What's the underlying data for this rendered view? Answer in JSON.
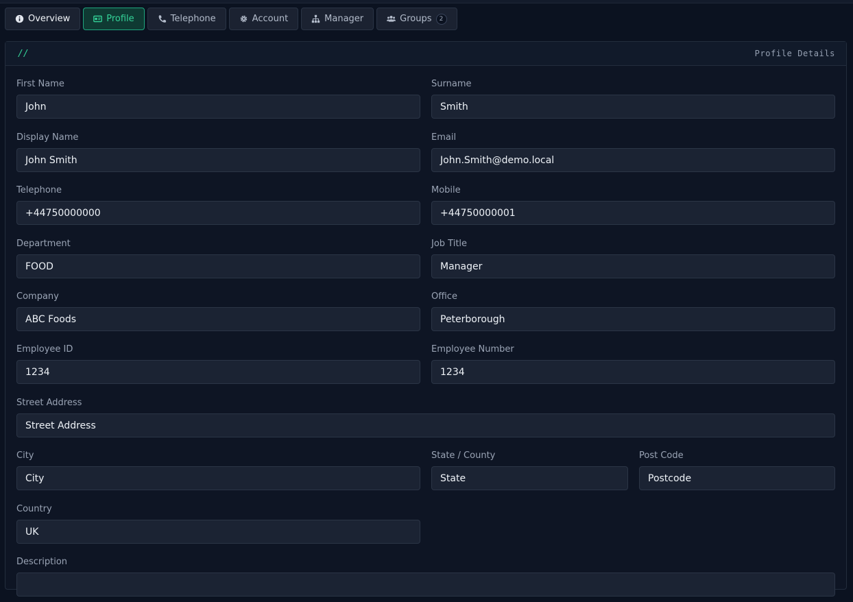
{
  "tabs": [
    {
      "label": "Overview",
      "icon": "info-icon"
    },
    {
      "label": "Profile",
      "icon": "id-card-icon"
    },
    {
      "label": "Telephone",
      "icon": "phone-icon"
    },
    {
      "label": "Account",
      "icon": "gear-icon"
    },
    {
      "label": "Manager",
      "icon": "sitemap-icon"
    },
    {
      "label": "Groups",
      "icon": "users-icon",
      "badge": "2"
    }
  ],
  "active_tab": "Profile",
  "panel": {
    "mark": "//",
    "title": "Profile Details"
  },
  "fields": {
    "first_name": {
      "label": "First Name",
      "value": "John"
    },
    "surname": {
      "label": "Surname",
      "value": "Smith"
    },
    "display_name": {
      "label": "Display Name",
      "value": "John Smith"
    },
    "email": {
      "label": "Email",
      "value": "John.Smith@demo.local"
    },
    "telephone": {
      "label": "Telephone",
      "value": "+44750000000"
    },
    "mobile": {
      "label": "Mobile",
      "value": "+44750000001"
    },
    "department": {
      "label": "Department",
      "value": "FOOD"
    },
    "job_title": {
      "label": "Job Title",
      "value": "Manager"
    },
    "company": {
      "label": "Company",
      "value": "ABC Foods"
    },
    "office": {
      "label": "Office",
      "value": "Peterborough"
    },
    "employee_id": {
      "label": "Employee ID",
      "value": "1234"
    },
    "employee_number": {
      "label": "Employee Number",
      "value": "1234"
    },
    "street_address": {
      "label": "Street Address",
      "value": "Street Address"
    },
    "city": {
      "label": "City",
      "value": "City"
    },
    "state": {
      "label": "State / County",
      "value": "State"
    },
    "post_code": {
      "label": "Post Code",
      "value": "Postcode"
    },
    "country": {
      "label": "Country",
      "value": "UK"
    },
    "description": {
      "label": "Description",
      "value": ""
    }
  },
  "colors": {
    "background": "#0b1220",
    "accent": "#34d399",
    "input_bg": "#1b2333",
    "border": "#2b3546"
  }
}
